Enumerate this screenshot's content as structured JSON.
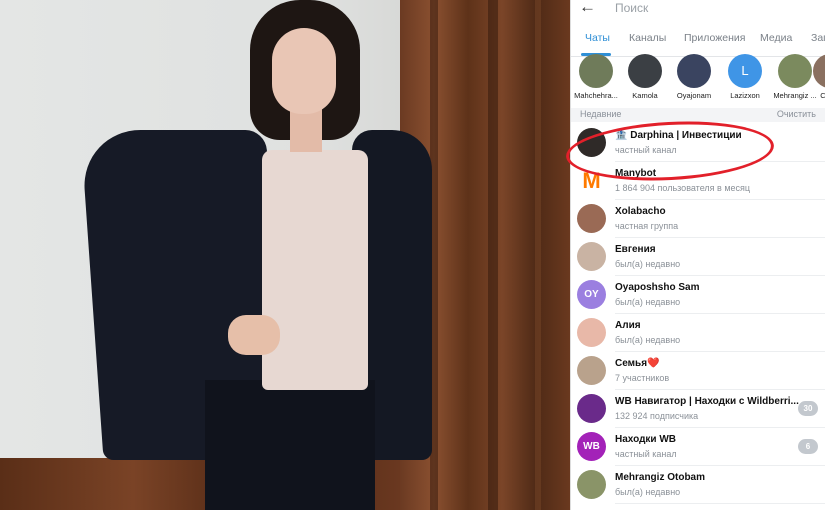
{
  "search": {
    "placeholder": "Поиск",
    "back_icon": "arrow-left-icon"
  },
  "tabs": [
    {
      "label": "Чаты",
      "active": true
    },
    {
      "label": "Каналы",
      "active": false
    },
    {
      "label": "Приложения",
      "active": false
    },
    {
      "label": "Медиа",
      "active": false
    },
    {
      "label": "Заг",
      "active": false
    }
  ],
  "stories": [
    {
      "name": "Mahchehra...",
      "color": "#6f7b5a"
    },
    {
      "name": "Kamola",
      "color": "#3b3f44"
    },
    {
      "name": "Oyajonam",
      "color": "#3a4460"
    },
    {
      "name": "Lazizxon",
      "color": "#3f95e6",
      "initial": "L"
    },
    {
      "name": "Mehrangiz ...",
      "color": "#7b8a5e"
    },
    {
      "name": "С",
      "color": "#8a7060"
    }
  ],
  "recent": {
    "label": "Недавние",
    "clear": "Очистить"
  },
  "chats": [
    {
      "name": "🏦 Darphina | Инвестиции",
      "sub": "частный канал",
      "color": "#2f2a28",
      "badge": ""
    },
    {
      "name": "Manybot",
      "sub": "1 864 904 пользователя в месяц",
      "color": "#ff7a00",
      "badge": "",
      "letter": "M"
    },
    {
      "name": "Xolabacho",
      "sub": "частная группа",
      "color": "#9a6a55",
      "badge": ""
    },
    {
      "name": "Евгения",
      "sub": "был(а) недавно",
      "color": "#c9b3a3",
      "badge": ""
    },
    {
      "name": "Oyaposhsho Sam",
      "sub": "был(а) недавно",
      "color": "#9b7fe0",
      "badge": "",
      "initial": "OY"
    },
    {
      "name": "Алия",
      "sub": "был(а) недавно",
      "color": "#e8b8a8",
      "badge": ""
    },
    {
      "name": "Семья❤️",
      "sub": "7 участников",
      "color": "#b9a28c",
      "badge": ""
    },
    {
      "name": "WB Навигатор | Находки с Wildberri...",
      "sub": "132 924 подписчика",
      "color": "#6a2a8a",
      "badge": "30"
    },
    {
      "name": "Находки WB",
      "sub": "частный канал",
      "color": "#a322b8",
      "badge": "6",
      "initial": "WB"
    },
    {
      "name": "Mehrangiz Otobam",
      "sub": "был(а) недавно",
      "color": "#8a9468",
      "badge": ""
    }
  ],
  "colors": {
    "accent": "#2f8fd6",
    "highlight_circle": "#e2202a"
  }
}
